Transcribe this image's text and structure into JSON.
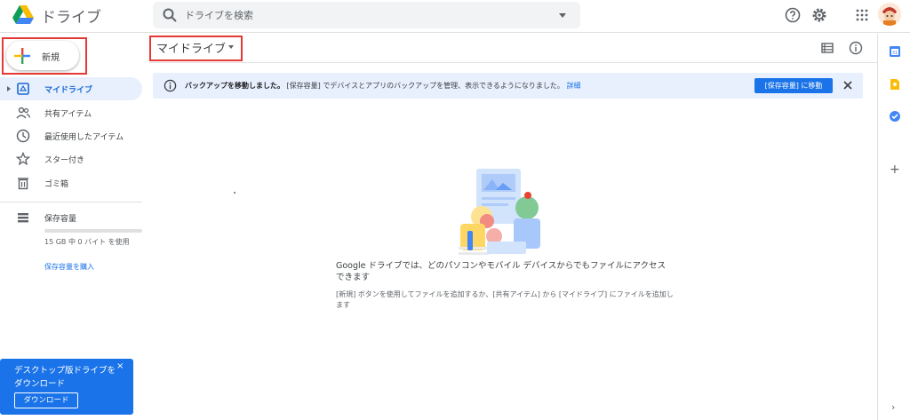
{
  "app": {
    "title": "ドライブ"
  },
  "search": {
    "placeholder": "ドライブを検索"
  },
  "sidebar": {
    "new_label": "新規",
    "items": [
      {
        "label": "マイドライブ",
        "icon": "my-drive-icon",
        "active": true
      },
      {
        "label": "共有アイテム",
        "icon": "shared-icon"
      },
      {
        "label": "最近使用したアイテム",
        "icon": "clock-icon"
      },
      {
        "label": "スター付き",
        "icon": "star-icon"
      },
      {
        "label": "ゴミ箱",
        "icon": "trash-icon"
      }
    ],
    "storage": {
      "label": "保存容量",
      "usage": "15 GB 中 0 バイト を使用",
      "used_fraction": 0,
      "buy_label": "保存容量を購入"
    },
    "download_card": {
      "text": "デスクトップ版ドライブを ダウンロード",
      "button": "ダウンロード",
      "close": "×"
    }
  },
  "main": {
    "title": "マイドライブ",
    "banner": {
      "bold": "バックアップを移動しました。",
      "text": "[保存容量] でデバイスとアプリのバックアップを管理、表示できるようになりました。",
      "link": "詳細",
      "button": "[保存容量] に移動"
    },
    "empty": {
      "title": "Google ドライブでは、どのパソコンやモバイル デバイスからでもファイルにアクセスできます",
      "subtitle": "[新規] ボタンを使用してファイルを追加するか、[共有アイテム] から [マイドライブ] にファイルを追加します"
    }
  },
  "colors": {
    "accent": "#1a73e8",
    "highlight_box": "#e53935",
    "active_bg": "#e8f0fe"
  }
}
